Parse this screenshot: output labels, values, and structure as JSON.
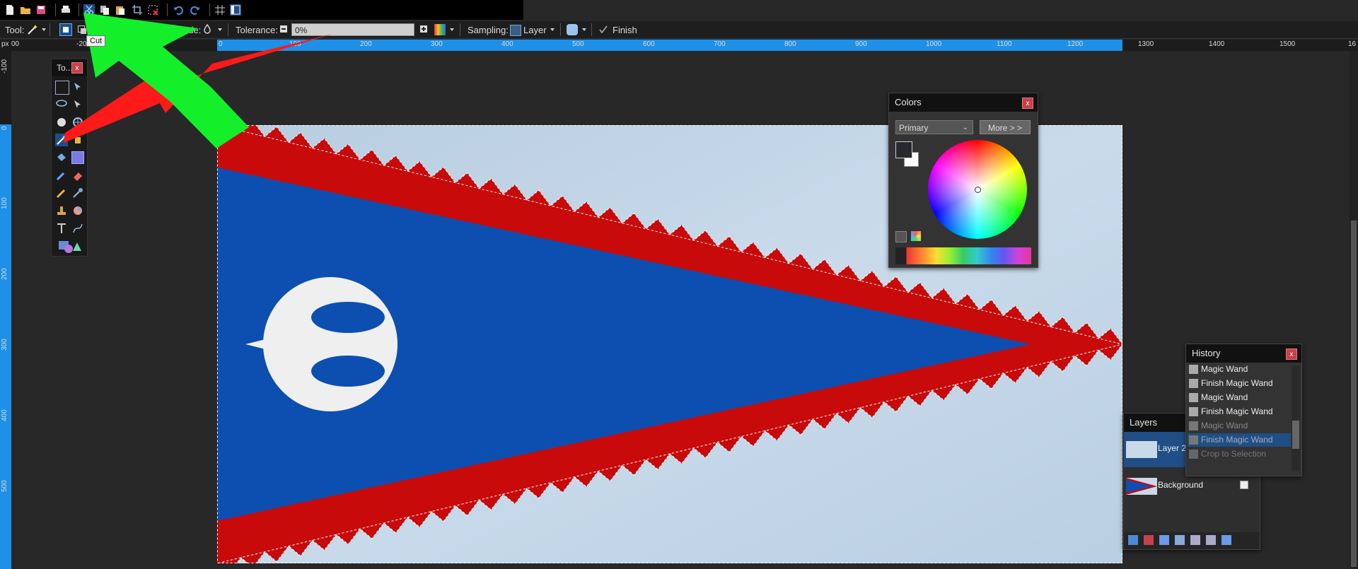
{
  "toolbar": {
    "icons": [
      "new-file-icon",
      "open-file-icon",
      "save-icon",
      "print-icon",
      "cut-icon",
      "copy-icon",
      "paste-icon",
      "crop-icon",
      "deselect-icon",
      "undo-icon",
      "redo-icon",
      "grid-icon",
      "ruler-icon"
    ]
  },
  "options": {
    "tool_label": "Tool:",
    "flood_mode_label": "Flood Mode:",
    "tolerance_label": "Tolerance:",
    "tolerance_value": "0%",
    "sampling_label": "Sampling:",
    "sampling_value": "Layer",
    "finish_label": "Finish"
  },
  "tooltip": {
    "text": "Cut"
  },
  "ruler": {
    "unit": "px",
    "h_labels": [
      "00",
      "-20",
      "0",
      "100",
      "200",
      "300",
      "400",
      "500",
      "600",
      "700",
      "800",
      "900",
      "1000",
      "1100",
      "1200",
      "1300",
      "1400",
      "1500",
      "16"
    ],
    "v_labels": [
      "-100",
      "0",
      "100",
      "200",
      "300",
      "400",
      "500"
    ]
  },
  "tools_panel": {
    "title": "To..."
  },
  "colors_panel": {
    "title": "Colors",
    "mode": "Primary",
    "more_label": "More > >",
    "primary_color": "#262a2e",
    "secondary_color": "#ffffff"
  },
  "history_panel": {
    "title": "History",
    "items": [
      "Magic Wand",
      "Finish Magic Wand",
      "Magic Wand",
      "Finish Magic Wand",
      "Magic Wand",
      "Finish Magic Wand",
      "Crop to Selection"
    ]
  },
  "layers_panel": {
    "title": "Layers",
    "layers": [
      {
        "name": "Layer 2",
        "visible": true
      },
      {
        "name": "Background",
        "visible": true
      }
    ]
  },
  "colors": {
    "accent": "#1e90e8",
    "flag_blue": "#0d4fb0",
    "flag_red": "#c80a0a",
    "annotation_green": "#13f02a",
    "annotation_red": "#ff1a1a"
  }
}
